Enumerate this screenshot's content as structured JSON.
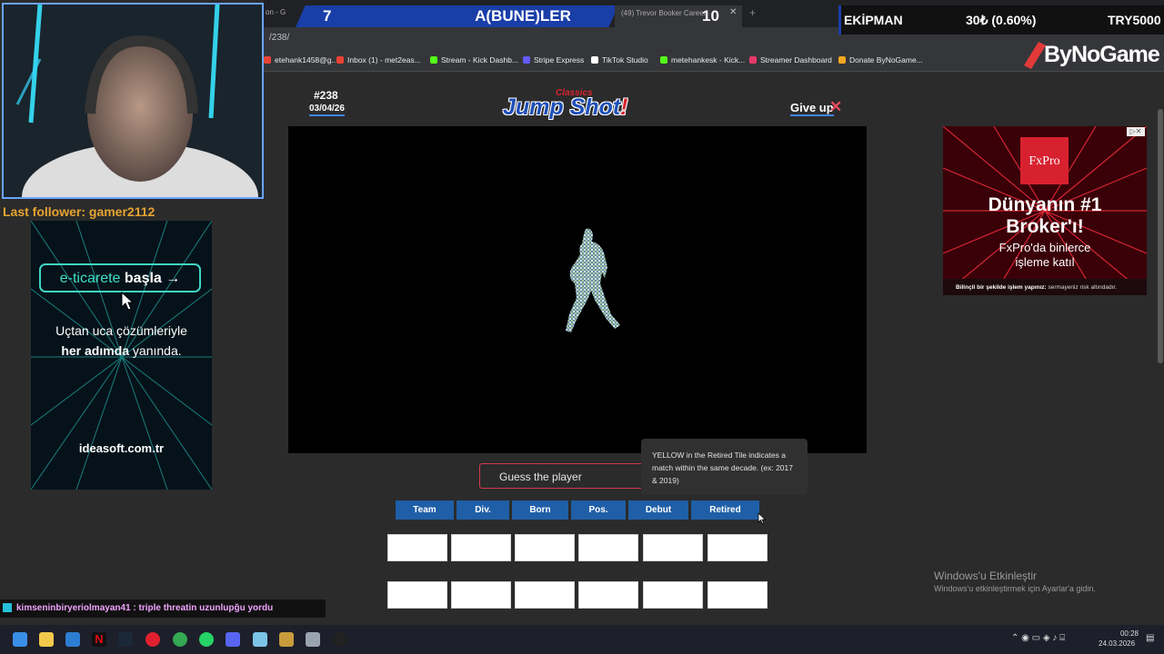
{
  "browser": {
    "url": "/238/",
    "tab_fragment": "on - G",
    "tab2_title": "(49) Trevor Booker Career",
    "tab2_close": "✕",
    "newtab": "+",
    "bookmarks": [
      {
        "label": "etehank1458@g...",
        "color": "#ea4335"
      },
      {
        "label": "Inbox (1) - met2eas...",
        "color": "#ea4335"
      },
      {
        "label": "Stream - Kick Dashb...",
        "color": "#53fc18"
      },
      {
        "label": "Stripe Express",
        "color": "#635bff"
      },
      {
        "label": "TikTok Studio",
        "color": "#ffffff"
      },
      {
        "label": "metehankesk - Kick...",
        "color": "#53fc18"
      },
      {
        "label": "Streamer Dashboard",
        "color": "#e63a6a"
      },
      {
        "label": "Donate ByNoGame...",
        "color": "#f5a623"
      }
    ]
  },
  "overlay": {
    "score_left": "7",
    "team_name": "A(BUNE)LER",
    "score_right": "10",
    "ekip_label": "EKİPMAN",
    "ekip_value": "30₺ (0.60%)",
    "ekip_amount": "TRY5000",
    "sponsor": "ByNoGame",
    "last_follower": "Last follower: gamer2112"
  },
  "ad_left": {
    "btn_part1": "e-ticarete",
    "btn_part2": "başla",
    "btn_arrow": "→",
    "line1": "Uçtan uca çözümleriyle",
    "line2_bold": "her adımda",
    "line2_rest": " yanında.",
    "domain": "ideasoft.com.tr"
  },
  "ad_right": {
    "brand": "FxPro",
    "headline1": "Dünyanın #1",
    "headline2": "Broker'ı!",
    "sub1": "FxPro'da binlerce",
    "sub2": "işleme katıl",
    "disclaimer_bold": "Bilinçli bir şekilde işlem yapınız:",
    "disclaimer_rest": " sermayeniz risk altındadır."
  },
  "game": {
    "number": "#238",
    "date": "03/04/26",
    "logo_small": "Classics",
    "logo_main": "Jump Shot",
    "logo_bang": "!",
    "giveup": "Give up",
    "giveup_x": "✕",
    "guess_placeholder": "Guess the player",
    "tooltip": "YELLOW in the Retired Tile indicates a match within the same decade. (ex: 2017 & 2019)",
    "columns": [
      "Team",
      "Div.",
      "Born",
      "Pos.",
      "Debut",
      "Retired"
    ],
    "guess_rows": [
      [
        "",
        "",
        "",
        "",
        "",
        ""
      ],
      [
        "",
        "",
        "",
        "",
        "",
        ""
      ]
    ]
  },
  "windows": {
    "activation_title": "Windows'u Etkinleştir",
    "activation_sub": "Windows'u etkinleştirmek için Ayarlar'a gidin.",
    "time": "00:28",
    "date": "24.03.2026"
  },
  "chat": {
    "message": "kimseninbiryeriolmayan41 : triple threatin uzunlupğu yordu"
  }
}
